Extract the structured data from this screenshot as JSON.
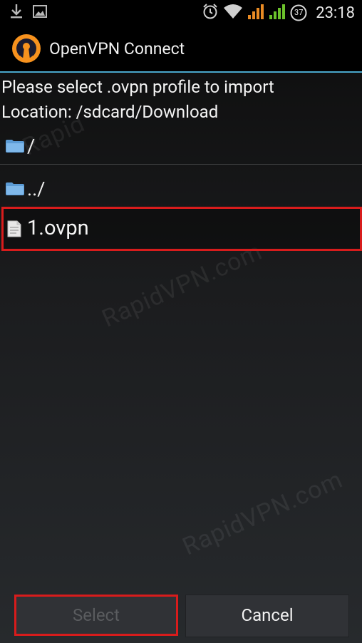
{
  "status_bar": {
    "time": "23:18",
    "battery_level": "37",
    "icons": [
      "download-icon",
      "image-icon",
      "alarm-icon",
      "wifi-icon",
      "signal-orange-icon",
      "signal-green-icon",
      "battery-icon"
    ]
  },
  "action_bar": {
    "title": "OpenVPN Connect",
    "logo": "openvpn-logo-icon"
  },
  "content": {
    "prompt": "Please select .ovpn profile to import",
    "location": "Location: /sdcard/Download",
    "rows": [
      {
        "label": "/",
        "icon": "folder-icon"
      },
      {
        "label": "../",
        "icon": "folder-icon"
      }
    ],
    "file": {
      "label": "1.ovpn",
      "icon": "file-icon",
      "highlighted": true
    }
  },
  "watermark": {
    "text_top": "Rapid",
    "text_mid": "RapidVPN.com",
    "text_low": "RapidVPN.com"
  },
  "buttons": {
    "select_label": "Select",
    "select_enabled": false,
    "cancel_label": "Cancel"
  },
  "colors": {
    "accent_divider": "#4aa8cc",
    "highlight": "#d81c1c",
    "logo_orange": "#f7921e"
  }
}
